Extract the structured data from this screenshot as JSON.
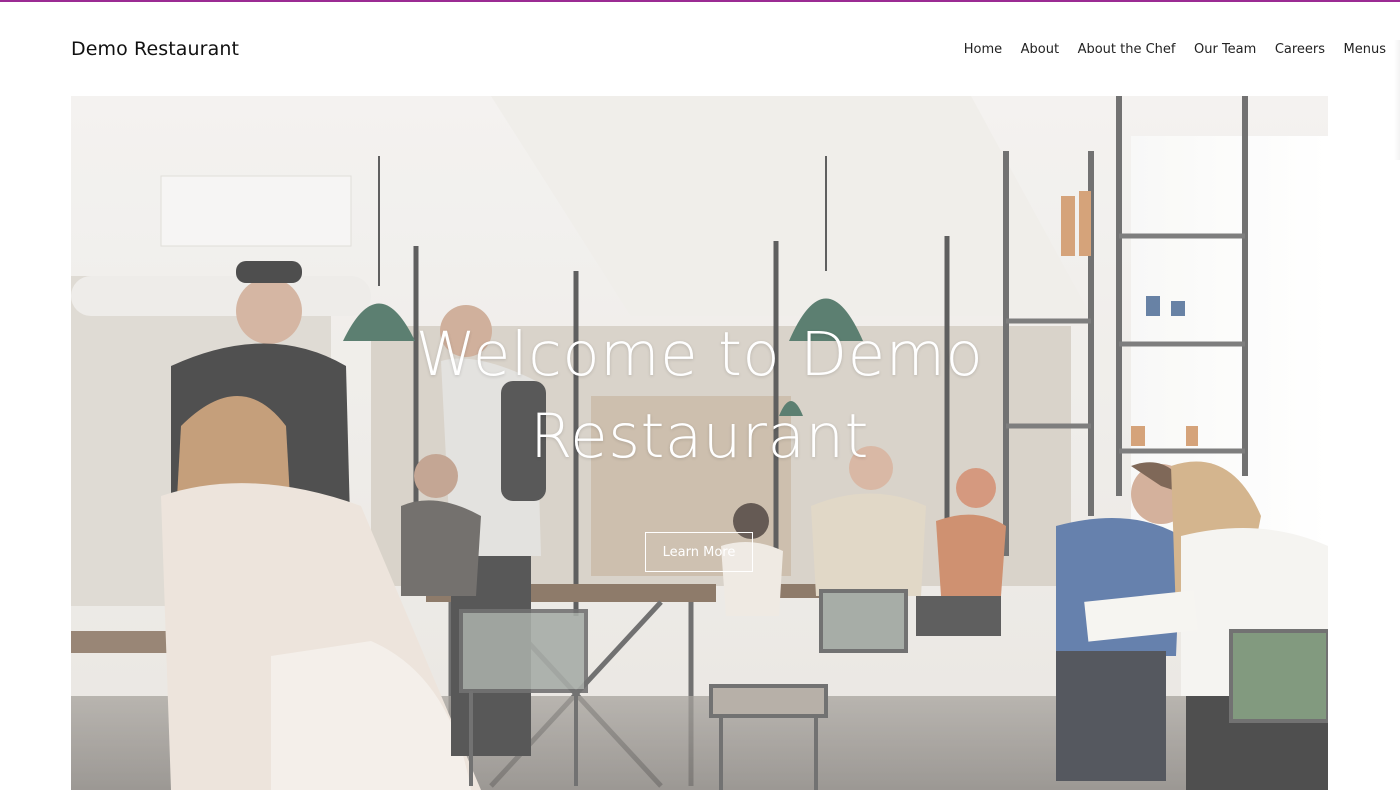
{
  "site": {
    "name": "Demo Restaurant",
    "accent_color": "#9b2b93"
  },
  "nav": {
    "items": [
      {
        "label": "Home"
      },
      {
        "label": "About"
      },
      {
        "label": "About the Chef"
      },
      {
        "label": "Our Team"
      },
      {
        "label": "Careers"
      },
      {
        "label": "Menus"
      }
    ]
  },
  "hero": {
    "title_line1": "Welcome to Demo",
    "title_line2": "Restaurant",
    "cta_label": "Learn More",
    "image_alt": "Busy restaurant interior with diners, pendant lamps and shelving"
  }
}
